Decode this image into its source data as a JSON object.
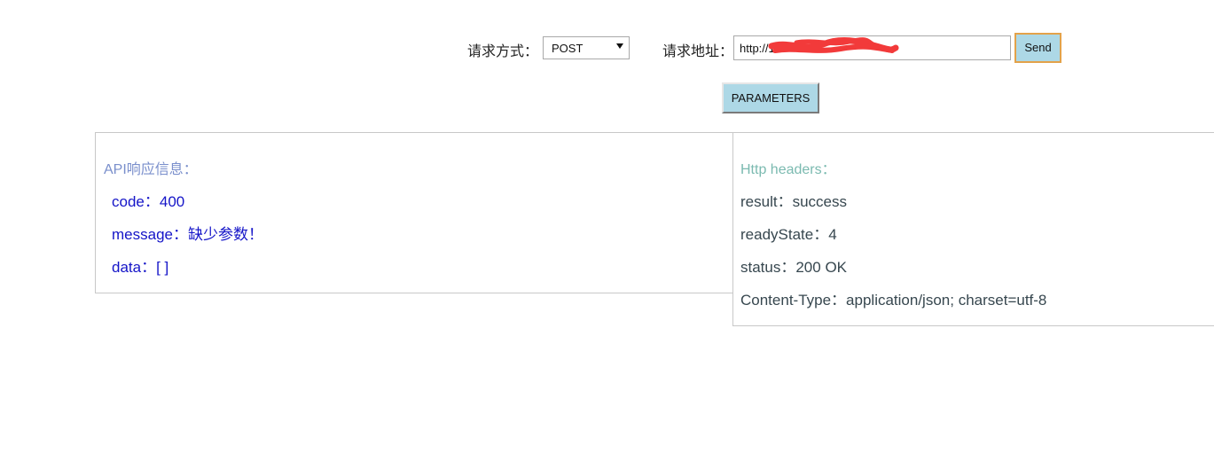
{
  "request": {
    "method_label": "请求方式：",
    "method_value": "POST",
    "url_label": "请求地址：",
    "url_value": "http://1",
    "send_label": "Send",
    "params_label": "PARAMETERS"
  },
  "api_response": {
    "title": "API响应信息：",
    "rows": [
      "code：400",
      "message：缺少参数！",
      "data：[  ]"
    ]
  },
  "http_headers": {
    "title": "Http headers：",
    "rows": [
      "result：success",
      "readyState：4",
      "status：200   OK",
      "Content-Type：application/json; charset=utf-8"
    ]
  },
  "colors": {
    "button_bg": "#add8e6",
    "send_border": "#e3a24a",
    "api_title": "#7a8fcc",
    "api_text": "#1515c8",
    "headers_title": "#7bbab0",
    "headers_text": "#37474f",
    "redaction": "#f23a3a"
  }
}
